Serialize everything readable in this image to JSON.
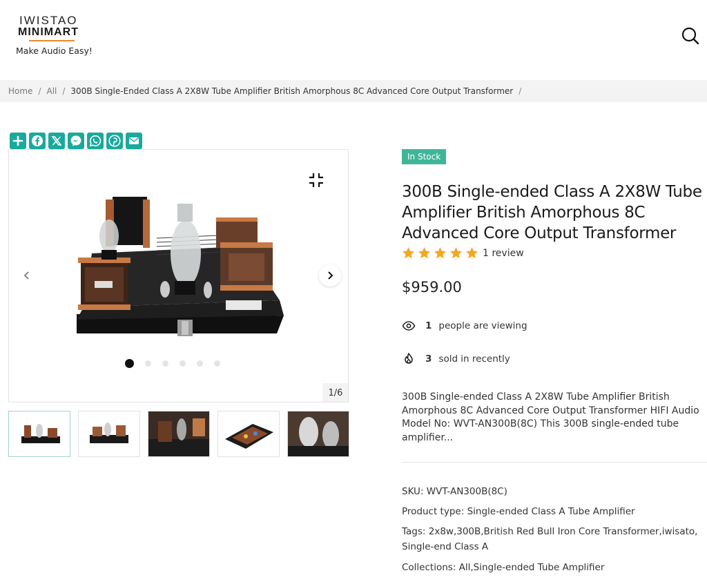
{
  "brand": {
    "line1": "IWISTAO",
    "line2": "MINIMART",
    "tagline": "Make Audio Easy!"
  },
  "header": {
    "search_icon": "search-icon"
  },
  "breadcrumb": {
    "home": "Home",
    "all": "All",
    "current": "300B Single-Ended Class A 2X8W Tube Amplifier British Amorphous 8C Advanced Core Output Transformer",
    "separator": "/"
  },
  "share": [
    "plus-icon",
    "facebook-icon",
    "x-icon",
    "messenger-icon",
    "whatsapp-icon",
    "pinterest-icon",
    "email-icon"
  ],
  "gallery": {
    "counter": "1/6",
    "dots": 6,
    "active_index": 0,
    "thumbnails": 5
  },
  "product": {
    "stock": "In Stock",
    "title": "300B Single-ended Class A 2X8W Tube Amplifier British Amorphous 8C Advanced Core Output Transformer",
    "rating": 5,
    "review_text": "1 review",
    "price": "$959.00",
    "viewing_count": "1",
    "viewing_text": "people are viewing",
    "sold_count": "3",
    "sold_text": "sold in recently",
    "description": "300B Single-ended Class A 2X8W Tube Amplifier British Amorphous 8C Advanced Core Output Transformer HIFI Audio Model No: WVT-AN300B(8C)    This 300B single-ended tube amplifier...",
    "star_color": "#f5a623"
  },
  "meta": {
    "sku_label": "SKU:",
    "sku": "WVT-AN300B(8C)",
    "type_label": "Product type:",
    "type": "Single-ended Class A Tube Amplifier",
    "tags_label": "Tags:",
    "tags": "2x8w,300B,British Red Bull Iron Core Transformer,iwisato, Single-end Class A",
    "collections_label": "Collections:",
    "collections": "All,Single-ended Tube Amplifier"
  }
}
